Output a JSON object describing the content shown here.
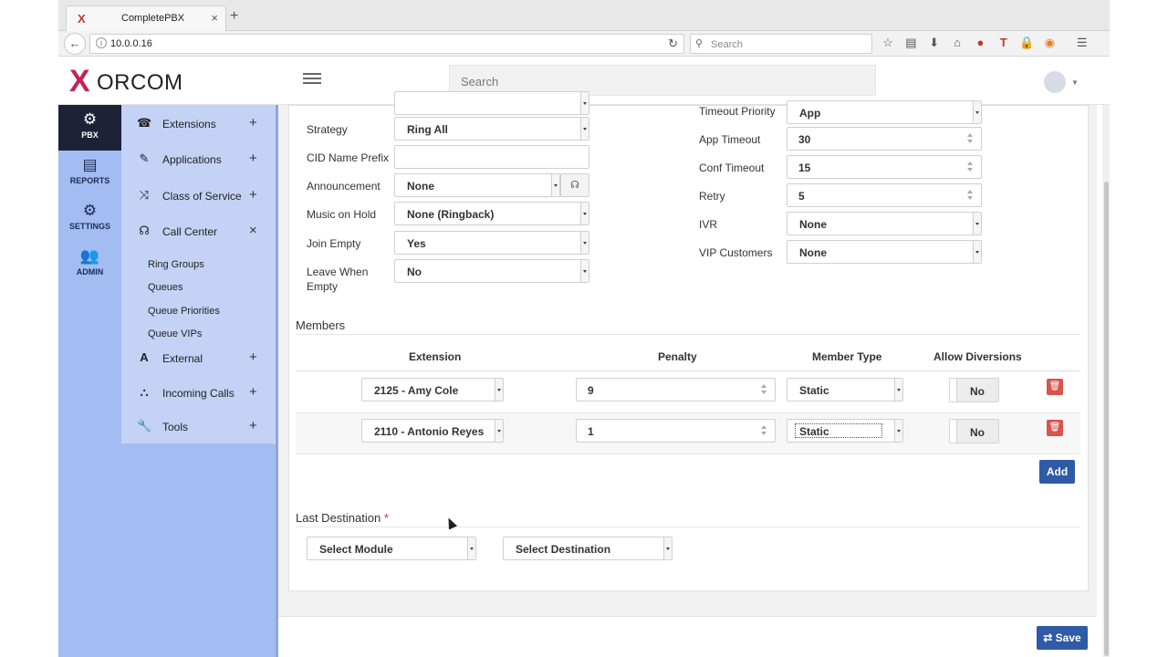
{
  "browser": {
    "tab_title": "CompletePBX",
    "tab_close": "×",
    "new_tab": "+",
    "url": "10.0.0.16",
    "search_placeholder": "Search",
    "favicon": "X"
  },
  "header": {
    "logo_text": "ORCOM",
    "logo_mark": "X",
    "search_placeholder": "Search"
  },
  "rail": [
    {
      "label": "PBX",
      "icon": "gear-icon",
      "glyph": "⚙"
    },
    {
      "label": "REPORTS",
      "icon": "document-icon",
      "glyph": "▤"
    },
    {
      "label": "SETTINGS",
      "icon": "gears-icon",
      "glyph": "⚙"
    },
    {
      "label": "ADMIN",
      "icon": "users-icon",
      "glyph": "👥"
    }
  ],
  "subnav": {
    "items": [
      {
        "label": "Extensions",
        "glyph": "☎",
        "toggle": "+"
      },
      {
        "label": "Applications",
        "glyph": "✎",
        "toggle": "+"
      },
      {
        "label": "Class of Service",
        "glyph": "⤨",
        "toggle": "+"
      },
      {
        "label": "Call Center",
        "glyph": "☊",
        "toggle": "×"
      }
    ],
    "call_center_children": [
      "Ring Groups",
      "Queues",
      "Queue Priorities",
      "Queue VIPs"
    ],
    "items_after": [
      {
        "label": "External",
        "glyph": "A",
        "toggle": "+"
      },
      {
        "label": "Incoming Calls",
        "glyph": "⛬",
        "toggle": "+"
      },
      {
        "label": "Tools",
        "glyph": "🔧",
        "toggle": "+"
      }
    ]
  },
  "form_left": {
    "strategy": {
      "label": "Strategy",
      "value": "Ring All"
    },
    "cid_prefix": {
      "label": "CID Name Prefix",
      "value": ""
    },
    "announcement": {
      "label": "Announcement",
      "value": "None"
    },
    "music_on_hold": {
      "label": "Music on Hold",
      "value": "None (Ringback)"
    },
    "join_empty": {
      "label": "Join Empty",
      "value": "Yes"
    },
    "leave_when_empty": {
      "label": "Leave When Empty",
      "value": "No"
    }
  },
  "form_right": {
    "timeout_priority": {
      "label": "Timeout Priority",
      "value": "App"
    },
    "app_timeout": {
      "label": "App Timeout",
      "value": "30"
    },
    "conf_timeout": {
      "label": "Conf Timeout",
      "value": "15"
    },
    "retry": {
      "label": "Retry",
      "value": "5"
    },
    "ivr": {
      "label": "IVR",
      "value": "None"
    },
    "vip_customers": {
      "label": "VIP Customers",
      "value": "None"
    }
  },
  "members": {
    "title": "Members",
    "columns": [
      "Extension",
      "Penalty",
      "Member Type",
      "Allow Diversions"
    ],
    "rows": [
      {
        "extension": "2125 - Amy Cole",
        "penalty": "9",
        "member_type": "Static",
        "allow_diversions": "No"
      },
      {
        "extension": "2110 - Antonio Reyes",
        "penalty": "1",
        "member_type": "Static",
        "allow_diversions": "No"
      }
    ],
    "add_label": "Add"
  },
  "last_destination": {
    "title": "Last Destination",
    "required_mark": "*",
    "module": "Select Module",
    "destination": "Select Destination"
  },
  "footer": {
    "save_label": "Save"
  },
  "colors": {
    "accent": "#2f5aa6",
    "rail": "#a3bdf2",
    "rail_active": "#1d2237",
    "danger": "#d9534f"
  }
}
